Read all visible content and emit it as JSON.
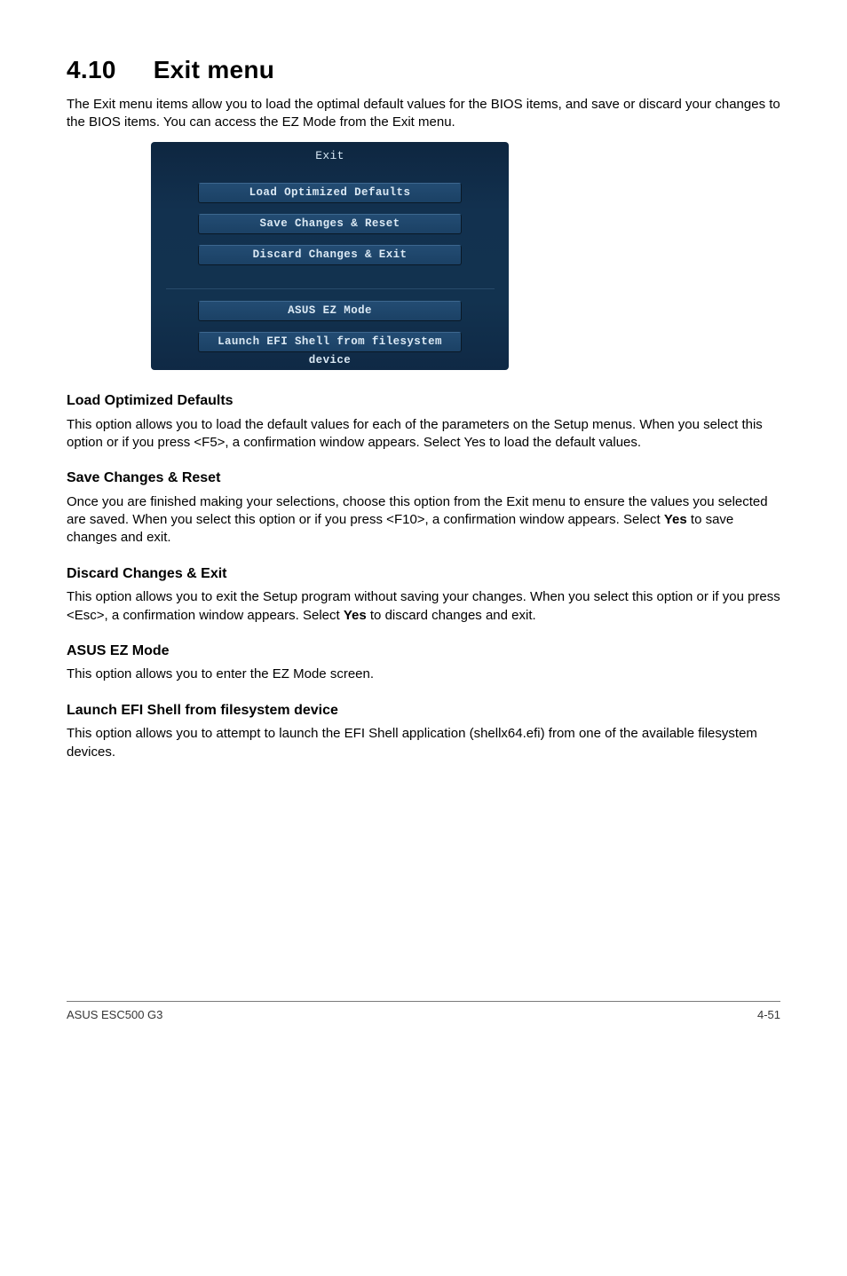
{
  "section": {
    "number": "4.10",
    "title": "Exit menu",
    "intro": "The Exit menu items allow you to load the optimal default values for the BIOS items, and save or discard your changes to the BIOS items. You can access the EZ Mode from the Exit menu."
  },
  "bios": {
    "header": "Exit",
    "buttons_top": [
      "Load Optimized Defaults",
      "Save Changes & Reset",
      "Discard Changes & Exit"
    ],
    "buttons_bottom": [
      "ASUS EZ Mode",
      "Launch EFI Shell from filesystem device"
    ]
  },
  "sections": [
    {
      "heading": "Load Optimized Defaults",
      "body": "This option allows you to load the default values for each of the parameters on the Setup menus. When you select this option or if you press <F5>, a confirmation window appears. Select Yes to load the default values."
    },
    {
      "heading": "Save Changes & Reset",
      "body_pre": "Once you are finished making your selections, choose this option from the Exit menu to ensure the values you selected are saved. When you select this option or if you press <F10>, a confirmation window appears. Select ",
      "body_bold": "Yes",
      "body_post": " to save changes and exit."
    },
    {
      "heading": "Discard Changes & Exit",
      "body_pre": "This option allows you to exit the Setup program without saving your changes. When you select this option or if you press <Esc>, a confirmation window appears. Select ",
      "body_bold": "Yes",
      "body_post": " to discard changes and exit."
    },
    {
      "heading": "ASUS EZ Mode",
      "body": "This option allows you to enter the EZ Mode screen."
    },
    {
      "heading": "Launch EFI Shell from filesystem device",
      "body": "This option allows you to attempt to launch the EFI Shell application (shellx64.efi) from one of the available filesystem devices."
    }
  ],
  "footer": {
    "left": "ASUS ESC500 G3",
    "right": "4-51"
  }
}
